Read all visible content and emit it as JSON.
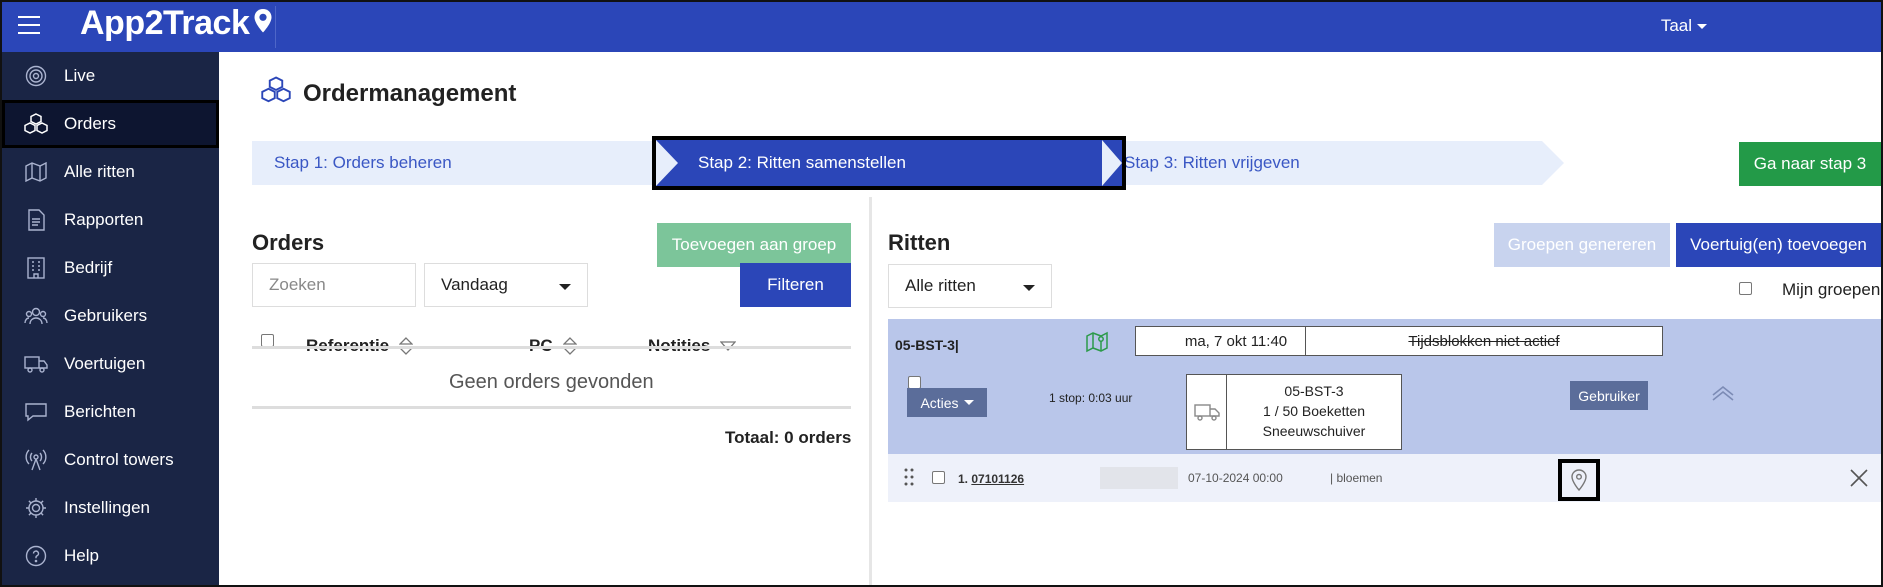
{
  "app": {
    "brand": "App2Track",
    "lang_label": "Taal"
  },
  "sidebar": {
    "items": [
      {
        "label": "Live",
        "icon": "live-signal-icon"
      },
      {
        "label": "Orders",
        "icon": "boxes-icon",
        "active": true
      },
      {
        "label": "Alle ritten",
        "icon": "map-icon"
      },
      {
        "label": "Rapporten",
        "icon": "document-icon"
      },
      {
        "label": "Bedrijf",
        "icon": "building-icon"
      },
      {
        "label": "Gebruikers",
        "icon": "users-icon"
      },
      {
        "label": "Voertuigen",
        "icon": "truck-icon"
      },
      {
        "label": "Berichten",
        "icon": "chat-icon"
      },
      {
        "label": "Control towers",
        "icon": "tower-icon"
      },
      {
        "label": "Instellingen",
        "icon": "gear-icon"
      },
      {
        "label": "Help",
        "icon": "help-icon"
      }
    ]
  },
  "page": {
    "title": "Ordermanagement"
  },
  "steps": {
    "step1": "Stap 1: Orders beheren",
    "step2": "Stap 2: Ritten samenstellen",
    "step3": "Stap 3: Ritten vrijgeven",
    "goto_button": "Ga naar stap 3"
  },
  "orders": {
    "title": "Orders",
    "add_to_group_button": "Toevoegen aan groep",
    "search_placeholder": "Zoeken",
    "date_select": "Vandaag",
    "filter_button": "Filteren",
    "columns": [
      "Referentie",
      "PC",
      "Notities"
    ],
    "empty_text": "Geen orders gevonden",
    "total_text": "Totaal: 0 orders"
  },
  "ritten": {
    "title": "Ritten",
    "generate_groups_button": "Groepen genereren",
    "add_vehicle_button": "Voertuig(en) toevoegen",
    "filter_select": "Alle ritten",
    "my_groups_label": "Mijn groepen",
    "route": {
      "name": "05-BST-3|",
      "date": "ma, 7 okt 11:40",
      "timeblocks": "Tijdsblokken niet actief",
      "actions_button": "Acties",
      "stops_text": "1 stop: 0:03 uur",
      "vehicle": {
        "plate": "05-BST-3",
        "capacity": "1 / 50 Boeketten",
        "name": "Sneeuwschuiver"
      },
      "user_button": "Gebruiker"
    },
    "stop": {
      "index_ref": "1. 07101126",
      "datetime": "07-10-2024 00:00",
      "note": "| bloemen"
    }
  },
  "colors": {
    "primary": "#2b46b8",
    "sidebar": "#1a2545",
    "green": "#239a48",
    "route_bg": "#b9c6ea"
  }
}
